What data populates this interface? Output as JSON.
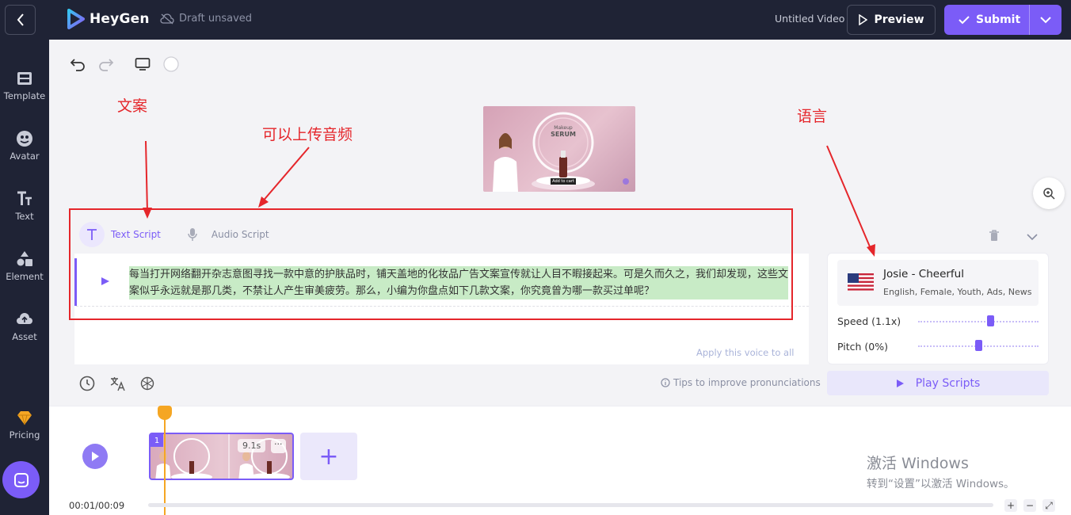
{
  "header": {
    "app_name": "HeyGen",
    "draft_status": "Draft unsaved",
    "video_title": "Untitled Video",
    "preview_label": "Preview",
    "submit_label": "Submit"
  },
  "sidebar": {
    "items": [
      {
        "label": "Template",
        "icon": "template-icon"
      },
      {
        "label": "Avatar",
        "icon": "avatar-icon"
      },
      {
        "label": "Text",
        "icon": "text-icon"
      },
      {
        "label": "Element",
        "icon": "element-icon"
      },
      {
        "label": "Asset",
        "icon": "asset-icon"
      }
    ],
    "pricing_label": "Pricing"
  },
  "annotations": {
    "copy": "文案",
    "upload_audio": "可以上传音频",
    "language": "语言"
  },
  "preview_card": {
    "line1": "Makeup",
    "line2": "SERUM",
    "cta": "Add to cart"
  },
  "script": {
    "tab_text": "Text Script",
    "tab_audio": "Audio Script",
    "content": "每当打开网络翻开杂志意图寻找一款中意的护肤品时，铺天盖地的化妆品广告文案宣传就让人目不暇接起来。可是久而久之，我们却发现，这些文案似乎永远就是那几类，不禁让人产生审美疲劳。那么，小编为你盘点如下几款文案，你究竟曾为哪一款买过单呢？",
    "apply_voice": "Apply this voice to all",
    "tips": "Tips to improve pronunciations"
  },
  "voice": {
    "name": "Josie - Cheerful",
    "tags": "English, Female, Youth, Ads, News",
    "speed_label": "Speed (1.1x)",
    "speed_value": 1.1,
    "pitch_label": "Pitch (0%)",
    "pitch_value": 0,
    "play_scripts_label": "Play Scripts"
  },
  "timeline": {
    "scene_number": "1",
    "scene_duration": "9.1s",
    "time_display": "00:01/00:09",
    "add_symbol": "+",
    "more_symbol": "···",
    "zoom_in": "+",
    "zoom_out": "−",
    "fit": "⤢"
  },
  "watermark": {
    "title": "激活 Windows",
    "subtitle": "转到“设置”以激活 Windows。"
  },
  "colors": {
    "accent": "#7b5cf7",
    "header_bg": "#1f2335",
    "annotation_red": "#e5262b",
    "playhead": "#f5a623"
  }
}
